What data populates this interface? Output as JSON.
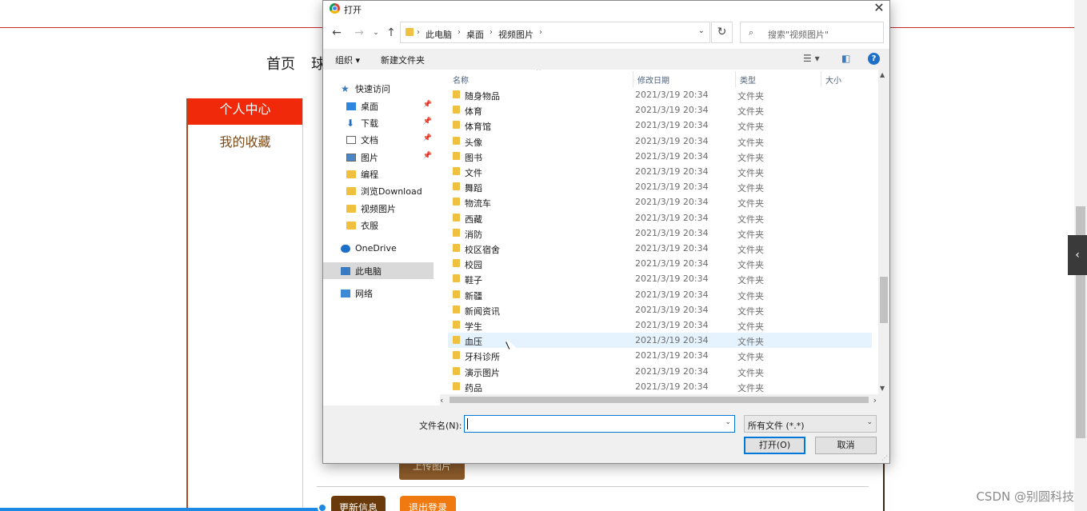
{
  "background_page": {
    "nav": [
      "首页",
      "球"
    ],
    "sidebar": {
      "active_item": "个人中心",
      "item": "我的收藏"
    },
    "upload_button": "上传图片",
    "update_button": "更新信息",
    "logout_button": "退出登录",
    "watermark": "CSDN @别圆科技"
  },
  "dialog": {
    "title": "打开",
    "address": {
      "crumbs": [
        "此电脑",
        "桌面",
        "视频图片"
      ]
    },
    "search": {
      "placeholder": "搜索\"视频图片\""
    },
    "toolbar": {
      "organize": "组织 ▾",
      "new_folder": "新建文件夹"
    },
    "nav_pane": [
      {
        "label": "快速访问",
        "icon": "star-icon",
        "selected": false,
        "pinned": false,
        "indent": 1
      },
      {
        "label": "桌面",
        "icon": "desktop-icon",
        "selected": false,
        "pinned": true,
        "indent": 2
      },
      {
        "label": "下载",
        "icon": "download-icon",
        "selected": false,
        "pinned": true,
        "indent": 2
      },
      {
        "label": "文档",
        "icon": "document-icon",
        "selected": false,
        "pinned": true,
        "indent": 2
      },
      {
        "label": "图片",
        "icon": "picture-icon",
        "selected": false,
        "pinned": true,
        "indent": 2
      },
      {
        "label": "编程",
        "icon": "folder-icon",
        "selected": false,
        "pinned": false,
        "indent": 2
      },
      {
        "label": "浏览Download",
        "icon": "folder-icon",
        "selected": false,
        "pinned": false,
        "indent": 2
      },
      {
        "label": "视频图片",
        "icon": "folder-icon",
        "selected": false,
        "pinned": false,
        "indent": 2
      },
      {
        "label": "衣服",
        "icon": "folder-icon",
        "selected": false,
        "pinned": false,
        "indent": 2
      },
      {
        "label": "OneDrive",
        "icon": "onedrive-icon",
        "selected": false,
        "pinned": false,
        "indent": 1
      },
      {
        "label": "此电脑",
        "icon": "computer-icon",
        "selected": true,
        "pinned": false,
        "indent": 1
      },
      {
        "label": "网络",
        "icon": "network-icon",
        "selected": false,
        "pinned": false,
        "indent": 1
      }
    ],
    "columns": {
      "name": "名称",
      "date": "修改日期",
      "type": "类型",
      "size": "大小"
    },
    "files": [
      {
        "name": "随身物品",
        "date": "2021/3/19 20:34",
        "type": "文件夹"
      },
      {
        "name": "体育",
        "date": "2021/3/19 20:34",
        "type": "文件夹"
      },
      {
        "name": "体育馆",
        "date": "2021/3/19 20:34",
        "type": "文件夹"
      },
      {
        "name": "头像",
        "date": "2021/3/19 20:34",
        "type": "文件夹"
      },
      {
        "name": "图书",
        "date": "2021/3/19 20:34",
        "type": "文件夹"
      },
      {
        "name": "文件",
        "date": "2021/3/19 20:34",
        "type": "文件夹"
      },
      {
        "name": "舞蹈",
        "date": "2021/3/19 20:34",
        "type": "文件夹"
      },
      {
        "name": "物流车",
        "date": "2021/3/19 20:34",
        "type": "文件夹"
      },
      {
        "name": "西藏",
        "date": "2021/3/19 20:34",
        "type": "文件夹"
      },
      {
        "name": "消防",
        "date": "2021/3/19 20:34",
        "type": "文件夹"
      },
      {
        "name": "校区宿舍",
        "date": "2021/3/19 20:34",
        "type": "文件夹"
      },
      {
        "name": "校园",
        "date": "2021/3/19 20:34",
        "type": "文件夹"
      },
      {
        "name": "鞋子",
        "date": "2021/3/19 20:34",
        "type": "文件夹"
      },
      {
        "name": "新疆",
        "date": "2021/3/19 20:34",
        "type": "文件夹"
      },
      {
        "name": "新闻资讯",
        "date": "2021/3/19 20:34",
        "type": "文件夹"
      },
      {
        "name": "学生",
        "date": "2021/3/19 20:34",
        "type": "文件夹"
      },
      {
        "name": "血压",
        "date": "2021/3/19 20:34",
        "type": "文件夹",
        "hover": true
      },
      {
        "name": "牙科诊所",
        "date": "2021/3/19 20:34",
        "type": "文件夹"
      },
      {
        "name": "演示图片",
        "date": "2021/3/19 20:34",
        "type": "文件夹"
      },
      {
        "name": "药品",
        "date": "2021/3/19 20:34",
        "type": "文件夹"
      }
    ],
    "filename_label": "文件名(N):",
    "filename_value": "",
    "filetype": "所有文件 (*.*)",
    "open_button": "打开(O)",
    "cancel_button": "取消"
  }
}
